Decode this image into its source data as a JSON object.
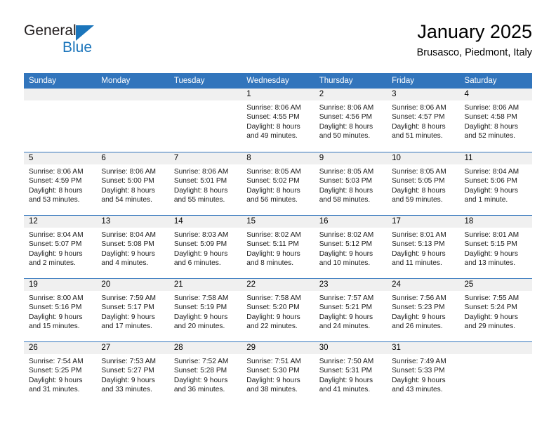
{
  "brand": {
    "word_one": "General",
    "word_two": "Blue",
    "accent_color": "#1b75bb"
  },
  "header": {
    "title": "January 2025",
    "location": "Brusasco, Piedmont, Italy"
  },
  "theme": {
    "header_blue": "#3275bc",
    "day_strip_gray": "#f0f0f0"
  },
  "weekdays": [
    "Sunday",
    "Monday",
    "Tuesday",
    "Wednesday",
    "Thursday",
    "Friday",
    "Saturday"
  ],
  "weeks": [
    [
      {
        "day": "",
        "sunrise": "",
        "sunset": "",
        "daylight_1": "",
        "daylight_2": ""
      },
      {
        "day": "",
        "sunrise": "",
        "sunset": "",
        "daylight_1": "",
        "daylight_2": ""
      },
      {
        "day": "",
        "sunrise": "",
        "sunset": "",
        "daylight_1": "",
        "daylight_2": ""
      },
      {
        "day": "1",
        "sunrise": "Sunrise: 8:06 AM",
        "sunset": "Sunset: 4:55 PM",
        "daylight_1": "Daylight: 8 hours",
        "daylight_2": "and 49 minutes."
      },
      {
        "day": "2",
        "sunrise": "Sunrise: 8:06 AM",
        "sunset": "Sunset: 4:56 PM",
        "daylight_1": "Daylight: 8 hours",
        "daylight_2": "and 50 minutes."
      },
      {
        "day": "3",
        "sunrise": "Sunrise: 8:06 AM",
        "sunset": "Sunset: 4:57 PM",
        "daylight_1": "Daylight: 8 hours",
        "daylight_2": "and 51 minutes."
      },
      {
        "day": "4",
        "sunrise": "Sunrise: 8:06 AM",
        "sunset": "Sunset: 4:58 PM",
        "daylight_1": "Daylight: 8 hours",
        "daylight_2": "and 52 minutes."
      }
    ],
    [
      {
        "day": "5",
        "sunrise": "Sunrise: 8:06 AM",
        "sunset": "Sunset: 4:59 PM",
        "daylight_1": "Daylight: 8 hours",
        "daylight_2": "and 53 minutes."
      },
      {
        "day": "6",
        "sunrise": "Sunrise: 8:06 AM",
        "sunset": "Sunset: 5:00 PM",
        "daylight_1": "Daylight: 8 hours",
        "daylight_2": "and 54 minutes."
      },
      {
        "day": "7",
        "sunrise": "Sunrise: 8:06 AM",
        "sunset": "Sunset: 5:01 PM",
        "daylight_1": "Daylight: 8 hours",
        "daylight_2": "and 55 minutes."
      },
      {
        "day": "8",
        "sunrise": "Sunrise: 8:05 AM",
        "sunset": "Sunset: 5:02 PM",
        "daylight_1": "Daylight: 8 hours",
        "daylight_2": "and 56 minutes."
      },
      {
        "day": "9",
        "sunrise": "Sunrise: 8:05 AM",
        "sunset": "Sunset: 5:03 PM",
        "daylight_1": "Daylight: 8 hours",
        "daylight_2": "and 58 minutes."
      },
      {
        "day": "10",
        "sunrise": "Sunrise: 8:05 AM",
        "sunset": "Sunset: 5:05 PM",
        "daylight_1": "Daylight: 8 hours",
        "daylight_2": "and 59 minutes."
      },
      {
        "day": "11",
        "sunrise": "Sunrise: 8:04 AM",
        "sunset": "Sunset: 5:06 PM",
        "daylight_1": "Daylight: 9 hours",
        "daylight_2": "and 1 minute."
      }
    ],
    [
      {
        "day": "12",
        "sunrise": "Sunrise: 8:04 AM",
        "sunset": "Sunset: 5:07 PM",
        "daylight_1": "Daylight: 9 hours",
        "daylight_2": "and 2 minutes."
      },
      {
        "day": "13",
        "sunrise": "Sunrise: 8:04 AM",
        "sunset": "Sunset: 5:08 PM",
        "daylight_1": "Daylight: 9 hours",
        "daylight_2": "and 4 minutes."
      },
      {
        "day": "14",
        "sunrise": "Sunrise: 8:03 AM",
        "sunset": "Sunset: 5:09 PM",
        "daylight_1": "Daylight: 9 hours",
        "daylight_2": "and 6 minutes."
      },
      {
        "day": "15",
        "sunrise": "Sunrise: 8:02 AM",
        "sunset": "Sunset: 5:11 PM",
        "daylight_1": "Daylight: 9 hours",
        "daylight_2": "and 8 minutes."
      },
      {
        "day": "16",
        "sunrise": "Sunrise: 8:02 AM",
        "sunset": "Sunset: 5:12 PM",
        "daylight_1": "Daylight: 9 hours",
        "daylight_2": "and 10 minutes."
      },
      {
        "day": "17",
        "sunrise": "Sunrise: 8:01 AM",
        "sunset": "Sunset: 5:13 PM",
        "daylight_1": "Daylight: 9 hours",
        "daylight_2": "and 11 minutes."
      },
      {
        "day": "18",
        "sunrise": "Sunrise: 8:01 AM",
        "sunset": "Sunset: 5:15 PM",
        "daylight_1": "Daylight: 9 hours",
        "daylight_2": "and 13 minutes."
      }
    ],
    [
      {
        "day": "19",
        "sunrise": "Sunrise: 8:00 AM",
        "sunset": "Sunset: 5:16 PM",
        "daylight_1": "Daylight: 9 hours",
        "daylight_2": "and 15 minutes."
      },
      {
        "day": "20",
        "sunrise": "Sunrise: 7:59 AM",
        "sunset": "Sunset: 5:17 PM",
        "daylight_1": "Daylight: 9 hours",
        "daylight_2": "and 17 minutes."
      },
      {
        "day": "21",
        "sunrise": "Sunrise: 7:58 AM",
        "sunset": "Sunset: 5:19 PM",
        "daylight_1": "Daylight: 9 hours",
        "daylight_2": "and 20 minutes."
      },
      {
        "day": "22",
        "sunrise": "Sunrise: 7:58 AM",
        "sunset": "Sunset: 5:20 PM",
        "daylight_1": "Daylight: 9 hours",
        "daylight_2": "and 22 minutes."
      },
      {
        "day": "23",
        "sunrise": "Sunrise: 7:57 AM",
        "sunset": "Sunset: 5:21 PM",
        "daylight_1": "Daylight: 9 hours",
        "daylight_2": "and 24 minutes."
      },
      {
        "day": "24",
        "sunrise": "Sunrise: 7:56 AM",
        "sunset": "Sunset: 5:23 PM",
        "daylight_1": "Daylight: 9 hours",
        "daylight_2": "and 26 minutes."
      },
      {
        "day": "25",
        "sunrise": "Sunrise: 7:55 AM",
        "sunset": "Sunset: 5:24 PM",
        "daylight_1": "Daylight: 9 hours",
        "daylight_2": "and 29 minutes."
      }
    ],
    [
      {
        "day": "26",
        "sunrise": "Sunrise: 7:54 AM",
        "sunset": "Sunset: 5:25 PM",
        "daylight_1": "Daylight: 9 hours",
        "daylight_2": "and 31 minutes."
      },
      {
        "day": "27",
        "sunrise": "Sunrise: 7:53 AM",
        "sunset": "Sunset: 5:27 PM",
        "daylight_1": "Daylight: 9 hours",
        "daylight_2": "and 33 minutes."
      },
      {
        "day": "28",
        "sunrise": "Sunrise: 7:52 AM",
        "sunset": "Sunset: 5:28 PM",
        "daylight_1": "Daylight: 9 hours",
        "daylight_2": "and 36 minutes."
      },
      {
        "day": "29",
        "sunrise": "Sunrise: 7:51 AM",
        "sunset": "Sunset: 5:30 PM",
        "daylight_1": "Daylight: 9 hours",
        "daylight_2": "and 38 minutes."
      },
      {
        "day": "30",
        "sunrise": "Sunrise: 7:50 AM",
        "sunset": "Sunset: 5:31 PM",
        "daylight_1": "Daylight: 9 hours",
        "daylight_2": "and 41 minutes."
      },
      {
        "day": "31",
        "sunrise": "Sunrise: 7:49 AM",
        "sunset": "Sunset: 5:33 PM",
        "daylight_1": "Daylight: 9 hours",
        "daylight_2": "and 43 minutes."
      },
      {
        "day": "",
        "sunrise": "",
        "sunset": "",
        "daylight_1": "",
        "daylight_2": ""
      }
    ]
  ]
}
